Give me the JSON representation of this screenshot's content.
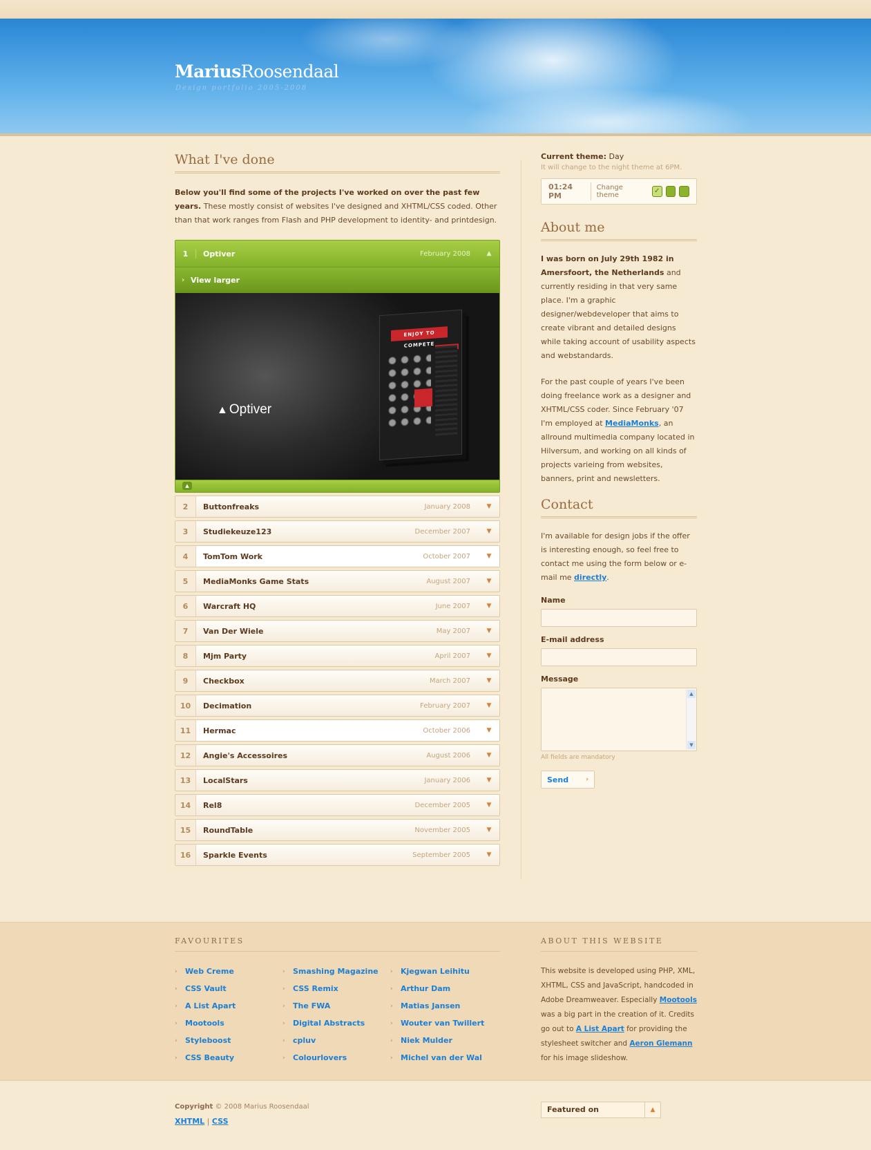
{
  "header": {
    "logo_bold": "Marius",
    "logo_light": "Roosendaal",
    "tagline": "Design portfolio 2005-2008"
  },
  "main": {
    "title": "What I've done",
    "intro_bold": "Below you'll find some of the projects I've worked on over the past few years.",
    "intro_rest": " These mostly consist of websites I've designed and XHTML/CSS coded. Other than that work ranges from Flash and PHP development to identity- and printdesign.",
    "active_project": {
      "num": "1",
      "name": "Optiver",
      "date": "February 2008",
      "view_larger": "View larger",
      "brand": "Optiver",
      "banner": "ENJOY TO COMPETE"
    },
    "projects": [
      {
        "num": "2",
        "name": "Buttonfreaks",
        "date": "January 2008"
      },
      {
        "num": "3",
        "name": "Studiekeuze123",
        "date": "December 2007"
      },
      {
        "num": "4",
        "name": "TomTom Work",
        "date": "October 2007"
      },
      {
        "num": "5",
        "name": "MediaMonks Game Stats",
        "date": "August 2007"
      },
      {
        "num": "6",
        "name": "Warcraft HQ",
        "date": "June 2007"
      },
      {
        "num": "7",
        "name": "Van Der Wiele",
        "date": "May 2007"
      },
      {
        "num": "8",
        "name": "Mjm Party",
        "date": "April 2007"
      },
      {
        "num": "9",
        "name": "Checkbox",
        "date": "March 2007"
      },
      {
        "num": "10",
        "name": "Decimation",
        "date": "February 2007"
      },
      {
        "num": "11",
        "name": "Hermac",
        "date": "October 2006"
      },
      {
        "num": "12",
        "name": "Angie's Accessoires",
        "date": "August 2006"
      },
      {
        "num": "13",
        "name": "LocalStars",
        "date": "January 2006"
      },
      {
        "num": "14",
        "name": "Rel8",
        "date": "December 2005"
      },
      {
        "num": "15",
        "name": "RoundTable",
        "date": "November 2005"
      },
      {
        "num": "16",
        "name": "Sparkle Events",
        "date": "September 2005"
      }
    ]
  },
  "sidebar": {
    "theme_label": "Current theme:",
    "theme_value": "Day",
    "theme_note": "It will change to the night theme at 6PM.",
    "time": "01:24 PM",
    "change_theme": "Change theme",
    "about_title": "About me",
    "about_p1_bold": "I was born on July 29th 1982 in Amersfoort, the Netherlands",
    "about_p1_rest": " and currently residing in that very same place. I'm a graphic designer/webdeveloper that aims to create vibrant and detailed designs while taking account of usability aspects and webstandards.",
    "about_p2_a": "For the past couple of years I've been doing freelance work as a designer and XHTML/CSS coder. Since February '07 I'm employed at ",
    "about_p2_link": "MediaMonks",
    "about_p2_b": ", an allround multimedia company located in Hilversum, and working on all kinds of projects varieing from websites, banners, print and newsletters.",
    "contact_title": "Contact",
    "contact_p_a": "I'm available for design jobs if the offer is interesting enough, so feel free to contact me using the form below or e-mail me ",
    "contact_link": "directly",
    "contact_p_b": ".",
    "form": {
      "name_label": "Name",
      "email_label": "E-mail address",
      "message_label": "Message",
      "mandatory": "All fields are mandatory",
      "send": "Send"
    }
  },
  "footer": {
    "favourites_title": "FAVOURITES",
    "fav_col1": [
      "Web Creme",
      "CSS Vault",
      "A List Apart",
      "Mootools",
      "Styleboost",
      "CSS Beauty"
    ],
    "fav_col2": [
      "Smashing Magazine",
      "CSS Remix",
      "The FWA",
      "Digital Abstracts",
      "cpluv",
      "Colourlovers"
    ],
    "fav_col3": [
      "Kjegwan Leihitu",
      "Arthur Dam",
      "Matias Jansen",
      "Wouter van Twillert",
      "Niek Mulder",
      "Michel van der Wal"
    ],
    "about_title": "ABOUT THIS WEBSITE",
    "about_a": "This website is developed using PHP, XML, XHTML, CSS and JavaScript, handcoded in Adobe Dreamweaver. Especially ",
    "about_link1": "Mootools",
    "about_b": " was a big part in the creation of it. Credits go out to ",
    "about_link2": "A List Apart",
    "about_c": " for providing the stylesheet switcher and ",
    "about_link3": "Aeron Glemann",
    "about_d": " for his image slideshow."
  },
  "bottom": {
    "copyright_bold": "Copyright",
    "copyright_rest": " © 2008 Marius Roosendaal",
    "xhtml": "XHTML",
    "sep": "|",
    "css": "CSS",
    "featured": "Featured on"
  }
}
